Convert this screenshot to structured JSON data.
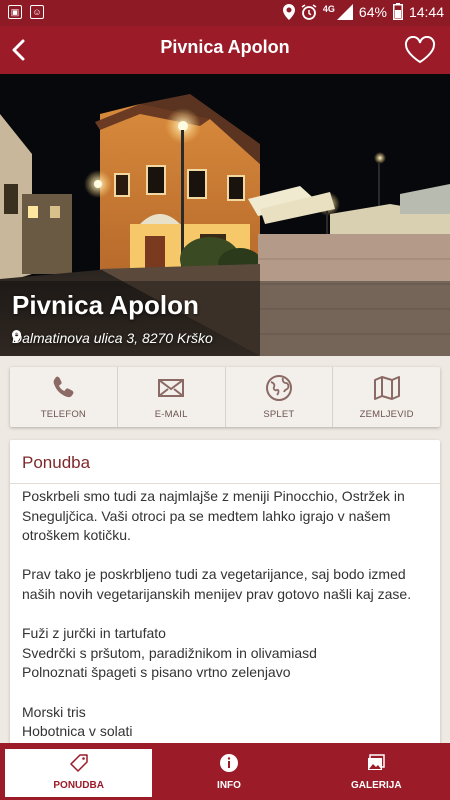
{
  "status_bar": {
    "network": "4G",
    "battery": "64%",
    "time": "14:44"
  },
  "app_bar": {
    "title": "Pivnica Apolon",
    "back_icon": "chevron-left-icon",
    "favorite_icon": "heart-outline-icon"
  },
  "hero": {
    "name": "Pivnica Apolon",
    "address": "Dalmatinova ulica 3, 8270 Krško"
  },
  "actions": [
    {
      "label": "TELEFON",
      "icon": "phone-icon"
    },
    {
      "label": "E-MAIL",
      "icon": "envelope-icon"
    },
    {
      "label": "SPLET",
      "icon": "globe-icon"
    },
    {
      "label": "ZEMLJEVID",
      "icon": "map-icon"
    }
  ],
  "offer": {
    "title": "Ponudba",
    "lines": [
      "Poskrbeli smo tudi za najmlajše z meniji Pinocchio, Ostržek in Sneguljčica. Vaši otroci pa se medtem lahko igrajo v našem otroškem kotičku.",
      "",
      "Prav tako je poskrbljeno tudi za vegetarijance, saj bodo izmed naših novih vegetarijanskih menijev prav gotovo našli kaj zase.",
      "",
      "Fuži z jurčki in tartufato",
      "Svedrčki s pršutom, paradižnikom in olivamiasd",
      "Polnoznati špageti s pisano vrtno zelenjavo",
      "",
      "Morski tris",
      "Hobotnica v solati"
    ]
  },
  "bottom_nav": [
    {
      "label": "PONUDBA",
      "icon": "tag-icon",
      "active": true
    },
    {
      "label": "INFO",
      "icon": "info-icon",
      "active": false
    },
    {
      "label": "GALERIJA",
      "icon": "gallery-icon",
      "active": false
    }
  ],
  "colors": {
    "brand": "#9b1b29",
    "status_bar": "#8e1a26",
    "card_title": "#7e2a2d"
  }
}
